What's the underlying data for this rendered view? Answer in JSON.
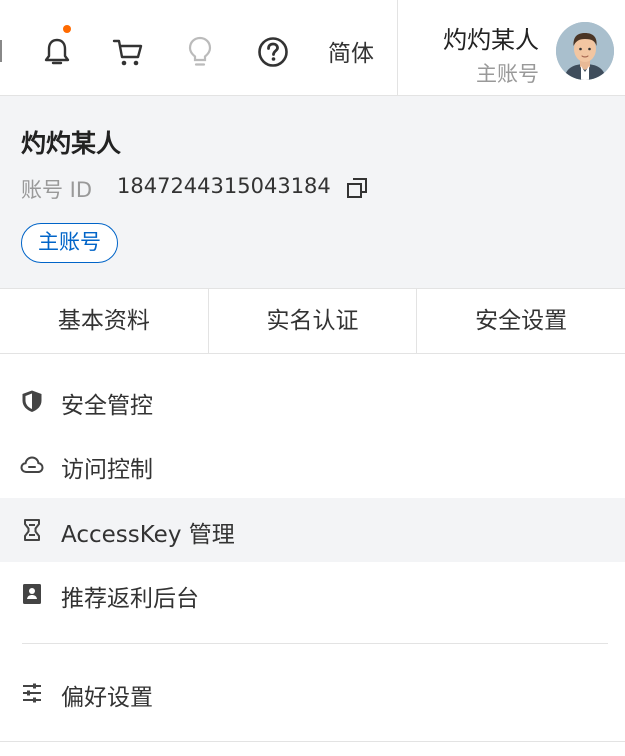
{
  "topbar": {
    "icons": [
      "bell-icon",
      "cart-icon",
      "lightbulb-icon",
      "help-icon"
    ],
    "notification_color": "#ff6a00",
    "lang_label": "简体",
    "user_name": "灼灼某人",
    "user_type": "主账号"
  },
  "account": {
    "name": "灼灼某人",
    "id_label": "账号 ID",
    "id_value": "1847244315043184",
    "badge": "主账号",
    "accent_color": "#0064c8"
  },
  "tabs": [
    {
      "label": "基本资料"
    },
    {
      "label": "实名认证"
    },
    {
      "label": "安全设置"
    }
  ],
  "menu": [
    {
      "label": "安全管控",
      "icon": "shield-icon"
    },
    {
      "label": "访问控制",
      "icon": "cloud-icon"
    },
    {
      "label": "AccessKey 管理",
      "icon": "key-icon",
      "active": true
    },
    {
      "label": "推荐返利后台",
      "icon": "card-icon"
    }
  ],
  "preferences": {
    "label": "偏好设置",
    "icon": "sliders-icon"
  }
}
